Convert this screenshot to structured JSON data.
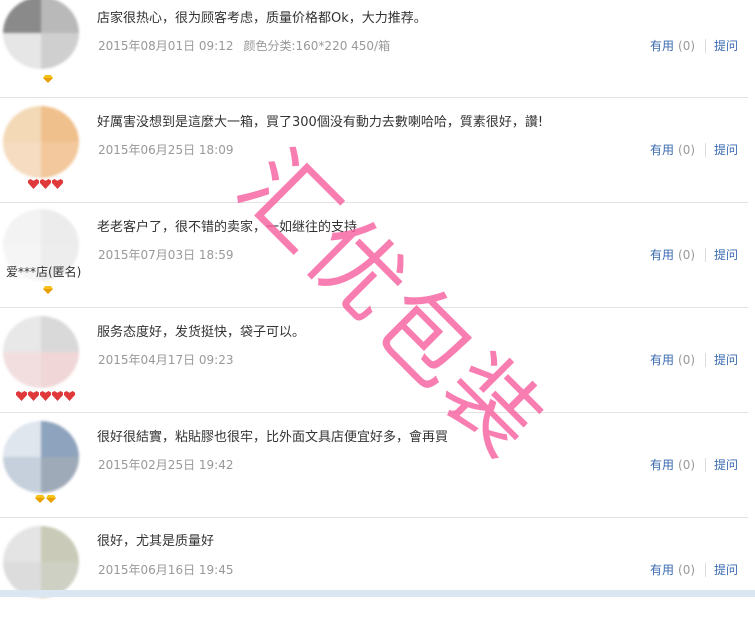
{
  "actions": {
    "useful_label": "有用",
    "ask_label": "提问"
  },
  "reviews": [
    {
      "comment": "店家很热心，很为顾客考虑，质量价格都Ok，大力推荐。",
      "date": "2015年08月01日 09:12",
      "sku": "颜色分类:160*220 450/箱",
      "useful_count": "(0)",
      "nickname": "",
      "level": "gold1",
      "avatar_colors": [
        "#8a8a8a",
        "#b9b9b9",
        "#cfcfcf",
        "#e6e6e6"
      ]
    },
    {
      "comment": "好厲害没想到是這麼大一箱，買了300個没有動力去數喇哈哈，質素很好，讚!",
      "date": "2015年06月25日 18:09",
      "sku": "",
      "useful_count": "(0)",
      "nickname": "",
      "level": "heart3",
      "avatar_colors": [
        "#f4d9b6",
        "#f0c08c",
        "#f6dcc0",
        "#f2c89c"
      ]
    },
    {
      "comment": "老老客户了，很不错的卖家，一如继往的支持",
      "date": "2015年07月03日 18:59",
      "sku": "",
      "useful_count": "(0)",
      "nickname": "爱***店(匿名)",
      "level": "gold1",
      "avatar_colors": [
        "#f3f3f3",
        "#ececec",
        "#f5f5f5",
        "#ededed"
      ]
    },
    {
      "comment": "服务态度好，发货挺快，袋子可以。",
      "date": "2015年04月17日 09:23",
      "sku": "",
      "useful_count": "(0)",
      "nickname": "",
      "level": "heart5",
      "avatar_colors": [
        "#e8e8e8",
        "#d9d9d9",
        "#f2dede",
        "#f0d6d6"
      ]
    },
    {
      "comment": "很好很結實，粘貼膠也很牢，比外面文具店便宜好多，會再買",
      "date": "2015年02月25日 19:42",
      "sku": "",
      "useful_count": "(0)",
      "nickname": "",
      "level": "gold2",
      "avatar_colors": [
        "#dfe6ee",
        "#8ea3bd",
        "#c5d0dc",
        "#9eaab8"
      ]
    },
    {
      "comment": "很好，尤其是质量好",
      "date": "2015年06月16日 19:45",
      "sku": "",
      "useful_count": "(0)",
      "nickname": "",
      "level": "none",
      "avatar_colors": [
        "#e4e4e4",
        "#c9cbb8",
        "#dcdcdc",
        "#cfd0c4"
      ]
    }
  ],
  "watermark": {
    "text": "汇优包装",
    "color": "#f660a0"
  }
}
